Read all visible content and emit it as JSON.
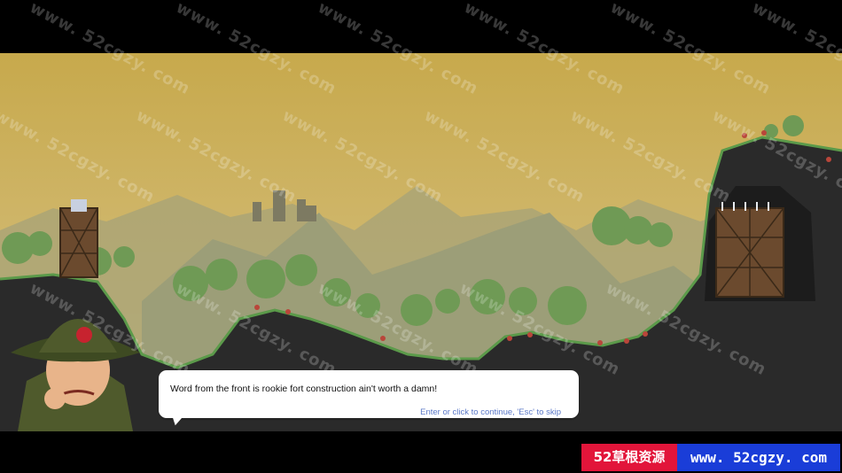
{
  "dialog": {
    "text": "Word from the front is rookie fort construction ain't worth a damn!",
    "hint": "Enter or click to continue, 'Esc' to skip"
  },
  "watermark": {
    "text": "www. 52cgzy. com"
  },
  "brand": {
    "red_label": "52草根资源",
    "blue_label": "www. 52cgzy. com"
  },
  "colors": {
    "sky": "#c9ac4a",
    "ground": "#2a2a2a",
    "dialog_hint": "#5b78c7",
    "brand_red": "#e2153a",
    "brand_blue": "#1a3dd8"
  },
  "icons": {
    "character": "commander-portrait",
    "fort": "wooden-fort-tower"
  }
}
